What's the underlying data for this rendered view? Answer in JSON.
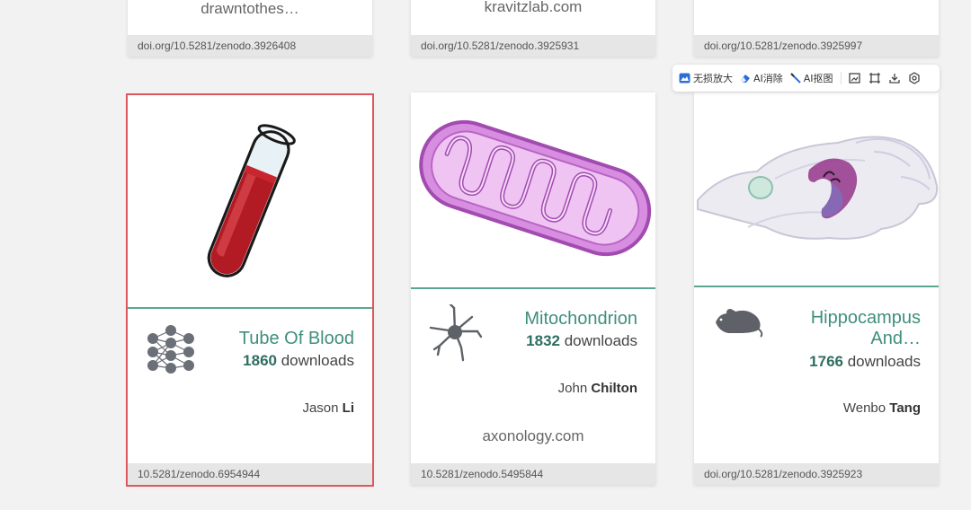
{
  "top_row": [
    {
      "site": "drawntothes…",
      "doi": "doi.org/10.5281/zenodo.3926408"
    },
    {
      "site": "kravitzlab.com",
      "doi": "doi.org/10.5281/zenodo.3925931"
    },
    {
      "site": "",
      "doi": "doi.org/10.5281/zenodo.3925997"
    }
  ],
  "cards": [
    {
      "title": "Tube Of Blood",
      "downloads_num": "1860",
      "downloads_label": "downloads",
      "author_first": "Jason",
      "author_last": "Li",
      "site": "",
      "doi": "10.5281/zenodo.6954944",
      "category_icon": "neural-network-icon"
    },
    {
      "title": "Mitochondrion",
      "downloads_num": "1832",
      "downloads_label": "downloads",
      "author_first": "John",
      "author_last": "Chilton",
      "site": "axonology.com",
      "doi": "10.5281/zenodo.5495844",
      "category_icon": "neuron-icon"
    },
    {
      "title_line1": "Hippocampus",
      "title_line2": "And…",
      "downloads_num": "1766",
      "downloads_label": "downloads",
      "author_first": "Wenbo",
      "author_last": "Tang",
      "site": "",
      "doi": "doi.org/10.5281/zenodo.3925923",
      "category_icon": "mouse-icon"
    }
  ],
  "toolbar": {
    "enlarge": "无损放大",
    "erase": "AI消除",
    "cutout": "AI抠图"
  },
  "colors": {
    "accent": "#3f8f7c",
    "selected_border": "#e0565e",
    "divider": "#5aa692"
  }
}
